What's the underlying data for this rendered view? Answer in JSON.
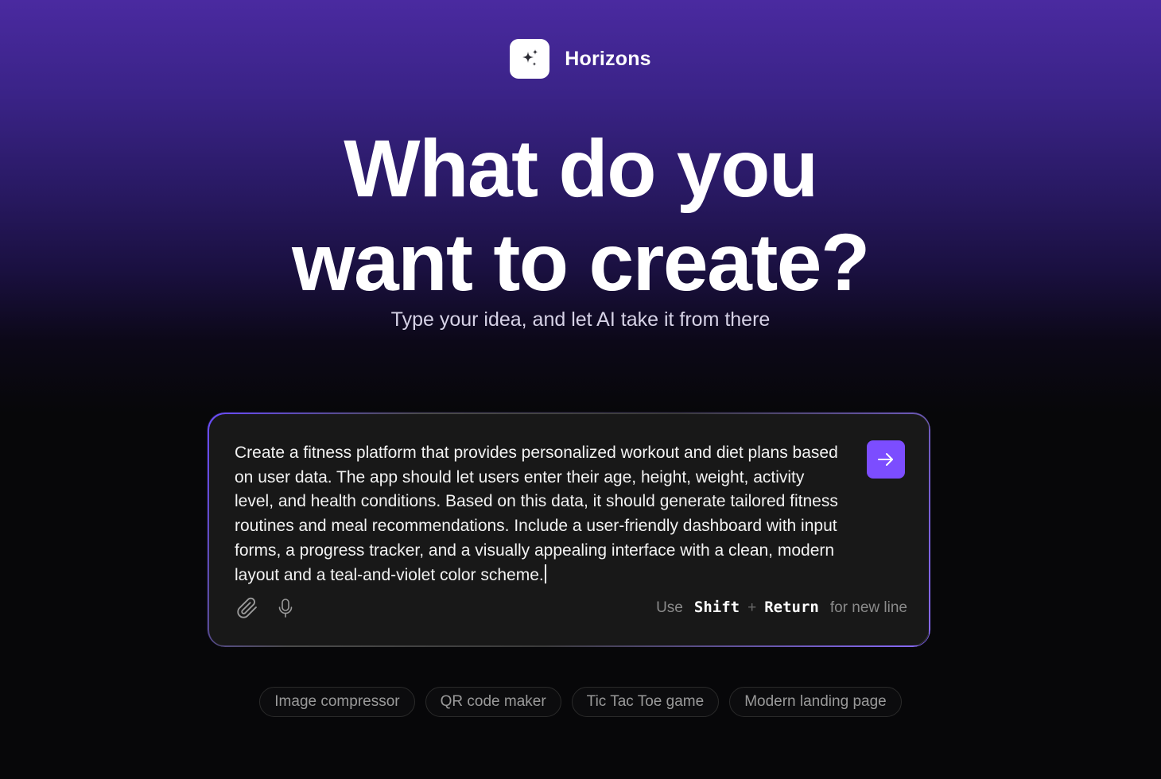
{
  "brand": {
    "name": "Horizons",
    "icon": "sparkles-icon"
  },
  "hero": {
    "title_line1": "What do you",
    "title_line2": "want to create?",
    "subtitle": "Type your idea, and let AI take it from there"
  },
  "prompt": {
    "value": "Create a fitness platform that provides personalized workout and diet plans based on user data. The app should let users enter their age, height, weight, activity level, and health conditions. Based on this data, it should generate tailored fitness routines and meal recommendations. Include a user-friendly dashboard with input forms, a progress tracker, and a visually appealing interface with a clean, modern layout and a teal-and-violet color scheme.",
    "send_icon": "arrow-right-icon",
    "attach_icon": "paperclip-icon",
    "mic_icon": "microphone-icon",
    "hint_prefix": "Use",
    "hint_key1": "Shift",
    "hint_plus": "+",
    "hint_key2": "Return",
    "hint_suffix": "for new line"
  },
  "suggestions": [
    "Image compressor",
    "QR code maker",
    "Tic Tac Toe game",
    "Modern landing page"
  ],
  "colors": {
    "accent": "#7c4dff",
    "background_top": "#4a2aa0",
    "background_bottom": "#070709",
    "panel": "#181818"
  }
}
